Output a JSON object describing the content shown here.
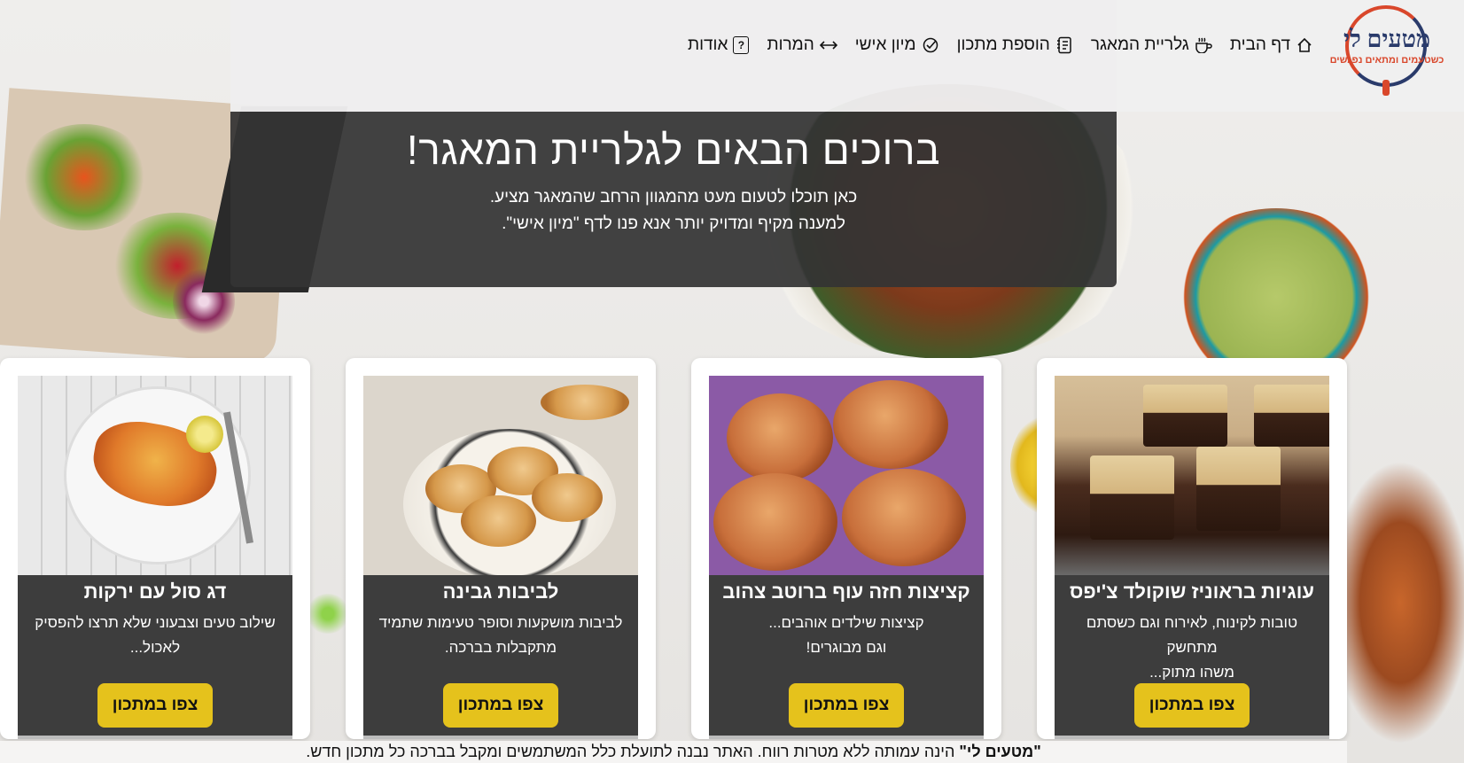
{
  "logo": {
    "title": "מטעים לי",
    "tagline": "כשטעמים ומתאים נפגשים"
  },
  "nav": {
    "items": [
      {
        "label": "דף הבית",
        "icon": "home-icon"
      },
      {
        "label": "גלריית המאגר",
        "icon": "cup-icon"
      },
      {
        "label": "הוספת מתכון",
        "icon": "notebook-icon"
      },
      {
        "label": "מיון אישי",
        "icon": "check-circle-icon"
      },
      {
        "label": "המרות",
        "icon": "arrows-horizontal-icon"
      },
      {
        "label": "אודות",
        "icon": "question-square-icon"
      }
    ]
  },
  "hero": {
    "title": "ברוכים הבאים לגלריית המאגר!",
    "line1": "כאן תוכלו לטעום מעט מהמגוון הרחב שהמאגר מציע.",
    "line2": "למענה מקיף ומדויק יותר אנא פנו לדף \"מיון אישי\"."
  },
  "cards": [
    {
      "title": "עוגיות בראוניז שוקולד צ'יפס",
      "desc1": "טובות לקינוח, לאירוח וגם כשסתם מתחשק",
      "desc2": "משהו מתוק...",
      "button": "צפו במתכון",
      "image": "brownies-photo"
    },
    {
      "title": "קציצות חזה עוף ברוטב צהוב",
      "desc1": "קציצות שילדים אוהבים...",
      "desc2": "וגם מבוגרים!",
      "button": "צפו במתכון",
      "image": "chicken-patties-photo"
    },
    {
      "title": "לביבות גבינה",
      "desc1": "לביבות מושקעות וסופר טעימות שתמיד",
      "desc2": "מתקבלות בברכה.",
      "button": "צפו במתכון",
      "image": "cheese-pancakes-photo"
    },
    {
      "title": "דג סול עם ירקות",
      "desc1": "שילוב טעים וצבעוני שלא תרצו להפסיק",
      "desc2": "לאכול...",
      "button": "צפו במתכון",
      "image": "sole-fish-photo"
    }
  ],
  "footer": {
    "brand": "\"מטעים לי\"",
    "text": " הינה עמותה ללא מטרות רווח. האתר נבנה לתועלת כלל המשתמשים ומקבל בברכה כל מתכון חדש."
  },
  "colors": {
    "button": "#e5c21c",
    "hero_bg": "#343434",
    "card_panel": "#3d3d3d",
    "logo_navy": "#2a3b6b",
    "logo_red": "#d9472b"
  }
}
